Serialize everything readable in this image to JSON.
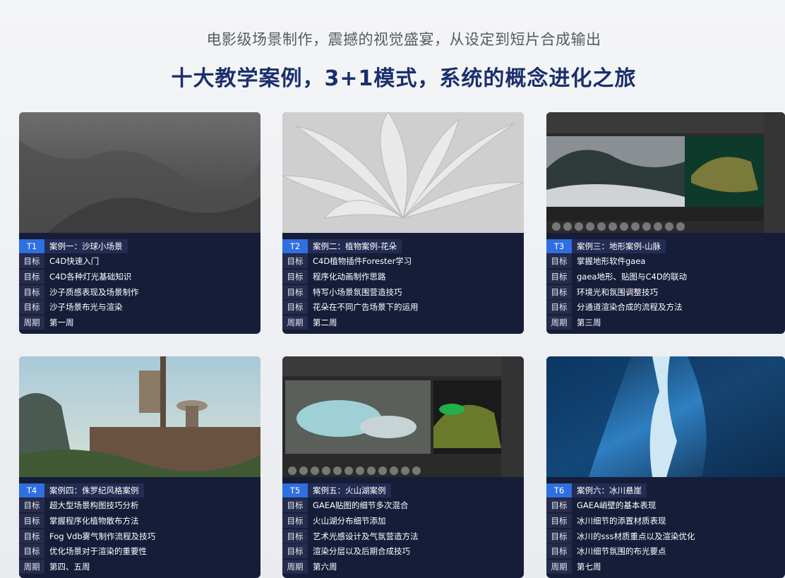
{
  "header": {
    "subtitle": "电影级场景制作，震撼的视觉盛宴，从设定到短片合成输出",
    "title": "十大教学案例，3+1模式，系统的概念进化之旅"
  },
  "labels": {
    "goal": "目标",
    "week": "周期"
  },
  "colors": {
    "title": "#1a2f6b",
    "badge": "#2f6fe0",
    "card_bg": "#161d39"
  },
  "cards": [
    {
      "tag": "T1",
      "name": "案例一：沙球小场景",
      "goals": [
        "C4D快速入门",
        "C4D各种灯光基础知识",
        "沙子质感表现及场景制作",
        "沙子场景布光与渲染"
      ],
      "week": "第一周"
    },
    {
      "tag": "T2",
      "name": "案例二：植物案例-花朵",
      "goals": [
        "C4D植物插件Forester学习",
        "程序化动画制作思路",
        "特写小场景氛围营造技巧",
        "花朵在不同广告场景下的运用"
      ],
      "week": "第二周"
    },
    {
      "tag": "T3",
      "name": "案例三：地形案例-山脉",
      "goals": [
        "掌握地形软件gaea",
        "gaea地形、贴图与C4D的联动",
        "环境光和氛围调整技巧",
        "分通道渲染合成的流程及方法"
      ],
      "week": "第三周"
    },
    {
      "tag": "T4",
      "name": "案例四：侏罗纪风格案例",
      "goals": [
        "超大型场景构图技巧分析",
        "掌握程序化植物散布方法",
        "Fog Vdb雾气制作流程及技巧",
        "优化场景对于渲染的重要性"
      ],
      "week": "第四、五周"
    },
    {
      "tag": "T5",
      "name": "案例五：火山湖案例",
      "goals": [
        "GAEA贴图的细节多次混合",
        "火山湖分布细节添加",
        "艺术光感设计及气氛营造方法",
        "渲染分层以及后期合成技巧"
      ],
      "week": "第六周"
    },
    {
      "tag": "T6",
      "name": "案例六：冰川悬崖",
      "goals": [
        " GAEA峭壁的基本表现",
        "冰川细节的添置材质表现",
        "冰川的sss材质重点以及渲染优化",
        "冰川细节氛围的布光要点"
      ],
      "week": "第七周"
    }
  ]
}
